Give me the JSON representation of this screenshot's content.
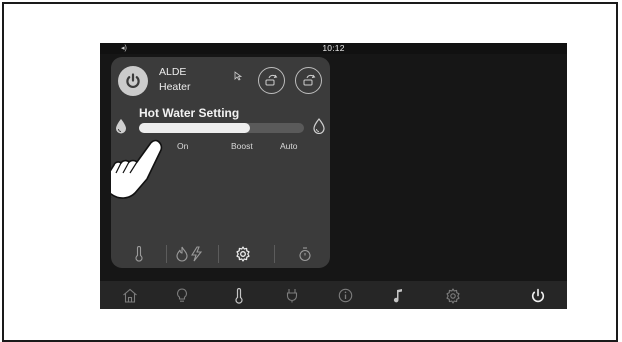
{
  "status_bar": {
    "speaker_icon": "speaker-icon",
    "time": "10:12"
  },
  "panel": {
    "title_line1": "ALDE",
    "title_line2": "Heater",
    "power_icon": "power-icon",
    "action_icons": [
      "heater-swap-icon",
      "heater-swap-alt-icon"
    ],
    "hot_water": {
      "title": "Hot Water Setting",
      "level_fraction": 0.67,
      "left_icon": "water-drop-icon",
      "right_icon": "water-drop-full-icon",
      "options": [
        "On",
        "Boost",
        "Auto"
      ]
    },
    "tabs": [
      "thermometer-icon",
      "flame-electric-icon",
      "gear-icon",
      "timer-icon"
    ],
    "selected_tab": "gear-icon"
  },
  "navbar": {
    "items": [
      "home-icon",
      "light-bulb-icon",
      "thermometer-icon",
      "plug-icon",
      "info-icon",
      "music-icon",
      "settings-icon",
      "power-icon"
    ]
  },
  "colors": {
    "screen": "#161616",
    "panel": "#3b3b3b",
    "accent_light": "#ededed"
  }
}
